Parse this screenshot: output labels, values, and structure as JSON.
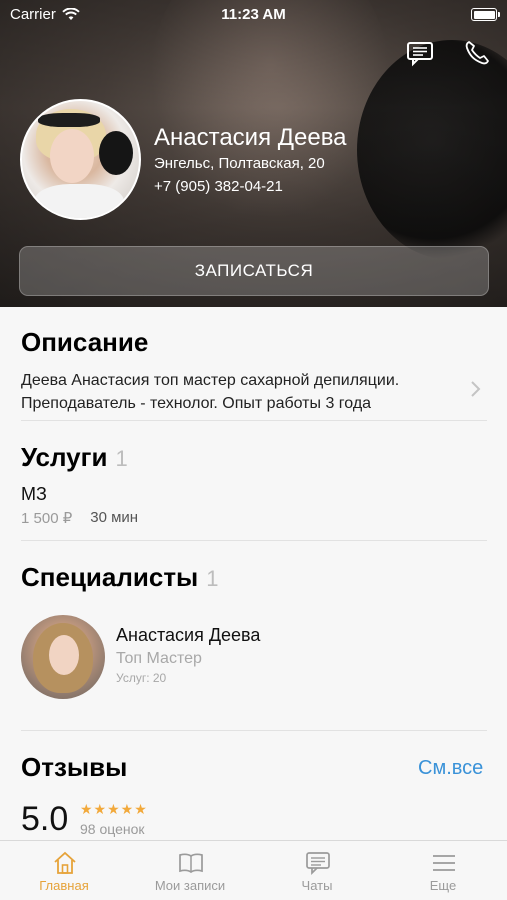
{
  "status_bar": {
    "carrier": "Carrier",
    "time": "11:23 AM"
  },
  "profile": {
    "name": "Анастасия Деева",
    "address": "Энгельс, Полтавская, 20",
    "phone": "+7 (905) 382-04-21",
    "book_label": "ЗАПИСАТЬСЯ"
  },
  "description": {
    "title": "Описание",
    "text": "Деева Анастасия топ мастер сахарной депиляции. Преподаватель - технолог. Опыт работы 3 года"
  },
  "services": {
    "title": "Услуги",
    "count": "1",
    "items": [
      {
        "name": "МЗ",
        "price": "1 500 ₽",
        "duration": "30 мин"
      }
    ]
  },
  "specialists": {
    "title": "Специалисты",
    "count": "1",
    "items": [
      {
        "name": "Анастасия Деева",
        "role": "Топ Мастер",
        "services": "Услуг: 20"
      }
    ]
  },
  "reviews": {
    "title": "Отзывы",
    "see_all": "См.все",
    "rating": "5.0",
    "stars": "★★★★★",
    "votes": "98 оценок"
  },
  "tabs": [
    {
      "label": "Главная",
      "icon": "home-icon",
      "active": true
    },
    {
      "label": "Мои записи",
      "icon": "book-icon",
      "active": false
    },
    {
      "label": "Чаты",
      "icon": "chat-icon",
      "active": false
    },
    {
      "label": "Еще",
      "icon": "menu-icon",
      "active": false
    }
  ],
  "colors": {
    "accent": "#e6a33a",
    "link": "#3a92d8",
    "star": "#f2a93b"
  }
}
